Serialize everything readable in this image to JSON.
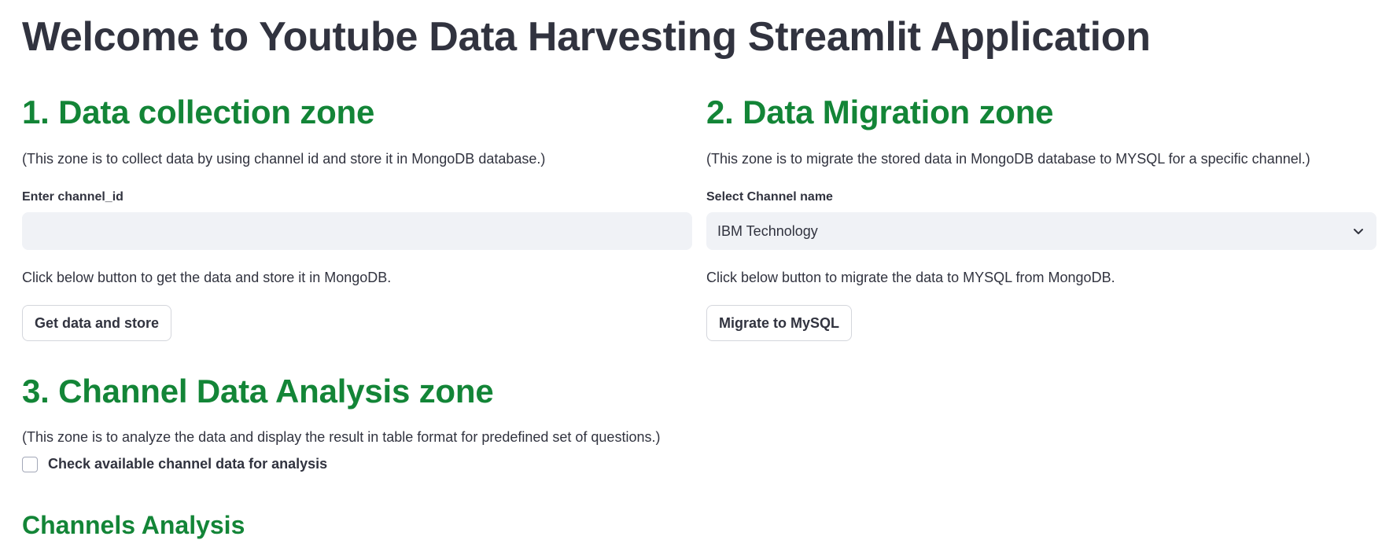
{
  "header": {
    "title": "Welcome to Youtube Data Harvesting Streamlit Application"
  },
  "collection": {
    "title": "1. Data collection zone",
    "description": "(This zone is to collect data by using channel id and store it in MongoDB database.)",
    "input_label": "Enter channel_id",
    "input_value": "",
    "helper": "Click below button to get the data and store it in MongoDB.",
    "button_label": "Get data and store"
  },
  "migration": {
    "title": "2. Data Migration zone",
    "description": "(This zone is to migrate the stored data in MongoDB database to MYSQL for a specific channel.)",
    "select_label": "Select Channel name",
    "select_value": "IBM Technology",
    "select_icon": "chevron-down-icon",
    "helper": "Click below button to migrate the data to MYSQL from MongoDB.",
    "button_label": "Migrate to MySQL"
  },
  "analysis": {
    "title": "3. Channel Data Analysis zone",
    "description": "(This zone is to analyze the data and display the result in table format for predefined set of questions.)",
    "checkbox_label": "Check available channel data for analysis",
    "checkbox_checked": false,
    "subheading": "Channels Analysis"
  },
  "colors": {
    "heading_green": "#138537",
    "text_dark": "#31333f",
    "input_bg": "#f0f2f6",
    "border": "#d4d6dc"
  }
}
